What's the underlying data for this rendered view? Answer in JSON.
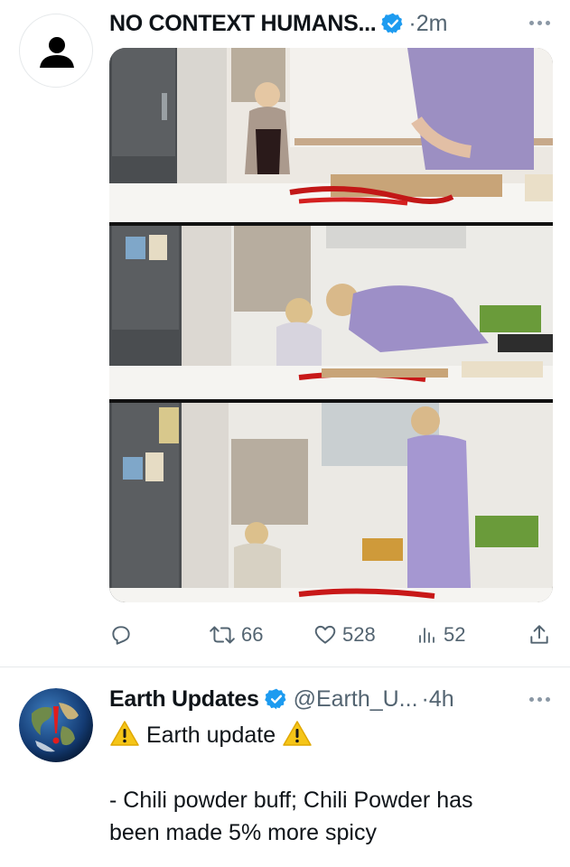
{
  "tweet1": {
    "author_name": "NO CONTEXT HUMANS...",
    "separator": "·",
    "time": "2m",
    "icons": {
      "avatar": "default-person-icon",
      "verified": "verified-badge-icon",
      "more": "more-dots-icon"
    },
    "actions": {
      "retweets": "66",
      "likes": "528",
      "views": "52"
    }
  },
  "tweet2": {
    "author_name": "Earth Updates",
    "handle": "@Earth_U...",
    "separator": "·",
    "time": "4h",
    "text_line1": "Earth update",
    "text_line2": "- Chili powder buff; Chili Powder has",
    "text_line3": "been made 5% more spicy"
  },
  "colors": {
    "text": "#0f1419",
    "muted": "#536471",
    "verified": "#1d9bf0",
    "divider": "#e6e9eb",
    "warning": "#f5c518"
  }
}
